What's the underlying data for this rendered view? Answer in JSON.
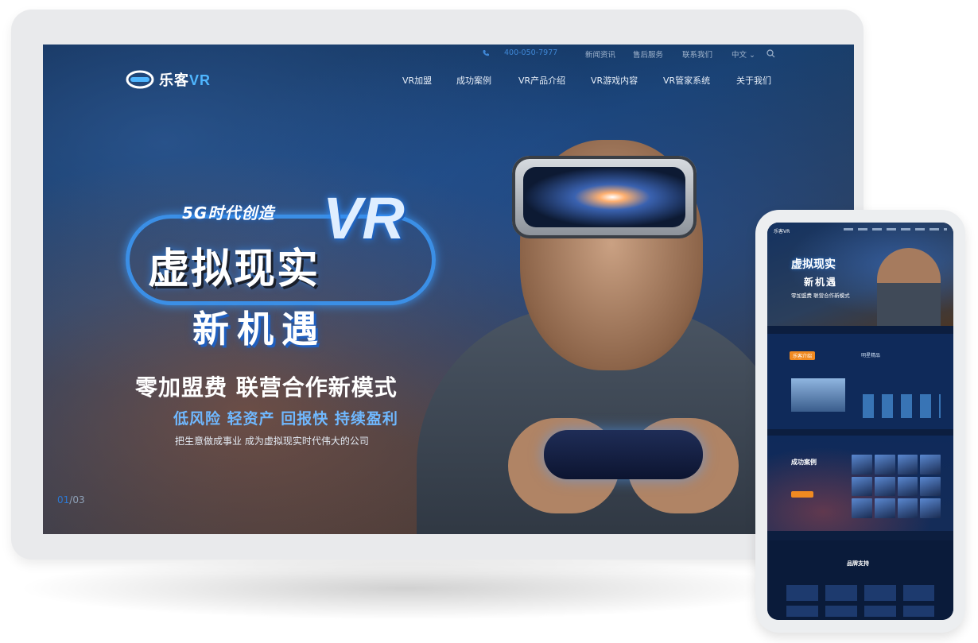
{
  "topbar": {
    "phone": "400-050-7977",
    "links": [
      "新闻资讯",
      "售后服务",
      "联系我们"
    ],
    "language": "中文 ⌄"
  },
  "logo": {
    "cn": "乐客",
    "vr": "VR"
  },
  "nav": [
    "VR加盟",
    "成功案例",
    "VR产品介绍",
    "VR游戏内容",
    "VR管家系统",
    "关于我们"
  ],
  "hero": {
    "tag": "5G时代创造",
    "vr": "VR",
    "title": "虚拟现实",
    "title2": "新机遇",
    "line1": "零加盟费 联营合作新模式",
    "line2": "低风险 轻资产 回报快 持续盈利",
    "line3": "把生意做成事业 成为虚拟现实时代伟大的公司",
    "slide_current": "01",
    "slide_total": "/03"
  },
  "mobile": {
    "logo": "乐客VR",
    "hero_title": "虚拟现实",
    "hero_title2": "新机遇",
    "hero_line": "零加盟费 联营合作新模式",
    "about_tag": "乐客介绍",
    "about_tag2": "明星精品",
    "cases_title": "成功案例",
    "support_title": "品牌支持"
  },
  "colors": {
    "accent": "#3b8fe6",
    "orange": "#f08a21"
  }
}
